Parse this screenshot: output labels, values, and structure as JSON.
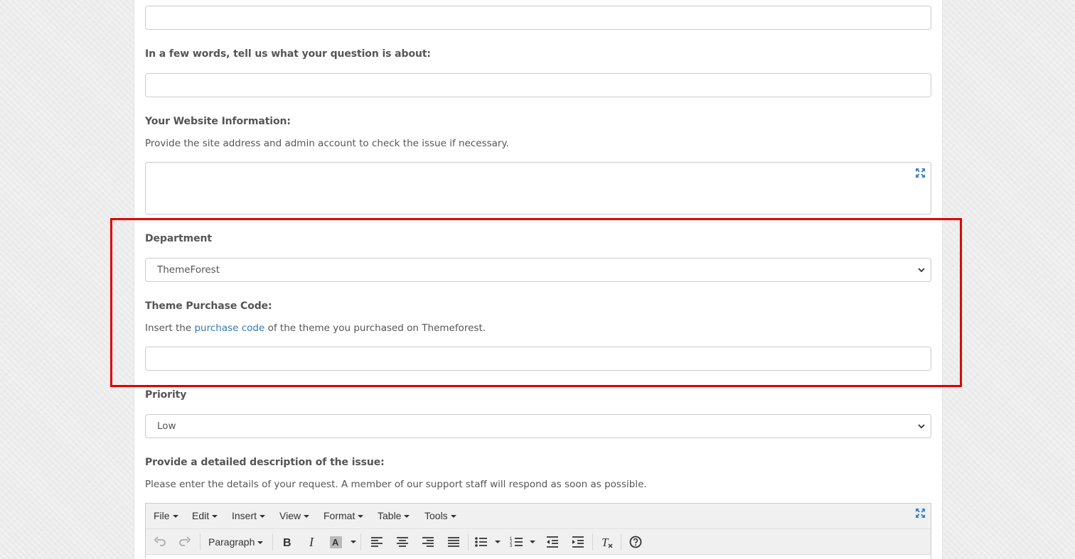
{
  "form": {
    "question_label": "In a few words, tell us what your question is about:",
    "website_label": "Your Website Information:",
    "website_help": "Provide the site address and admin account to check the issue if necessary.",
    "department_label": "Department",
    "department_value": "ThemeForest",
    "purchase_code_label": "Theme Purchase Code:",
    "purchase_help_before": "Insert the",
    "purchase_help_link": "purchase code",
    "purchase_help_after": "of the theme you purchased on Themeforest.",
    "priority_label": "Priority",
    "priority_value": "Low",
    "description_label": "Provide a detailed description of the issue:",
    "description_help": "Please enter the details of your request. A member of our support staff will respond as soon as possible."
  },
  "editor": {
    "menu": [
      "File",
      "Edit",
      "Insert",
      "View",
      "Format",
      "Table",
      "Tools"
    ],
    "block_format": "Paragraph"
  },
  "colors": {
    "highlight": "#e00000",
    "link": "#337ab7",
    "icon_blue": "#3a7bc8"
  }
}
